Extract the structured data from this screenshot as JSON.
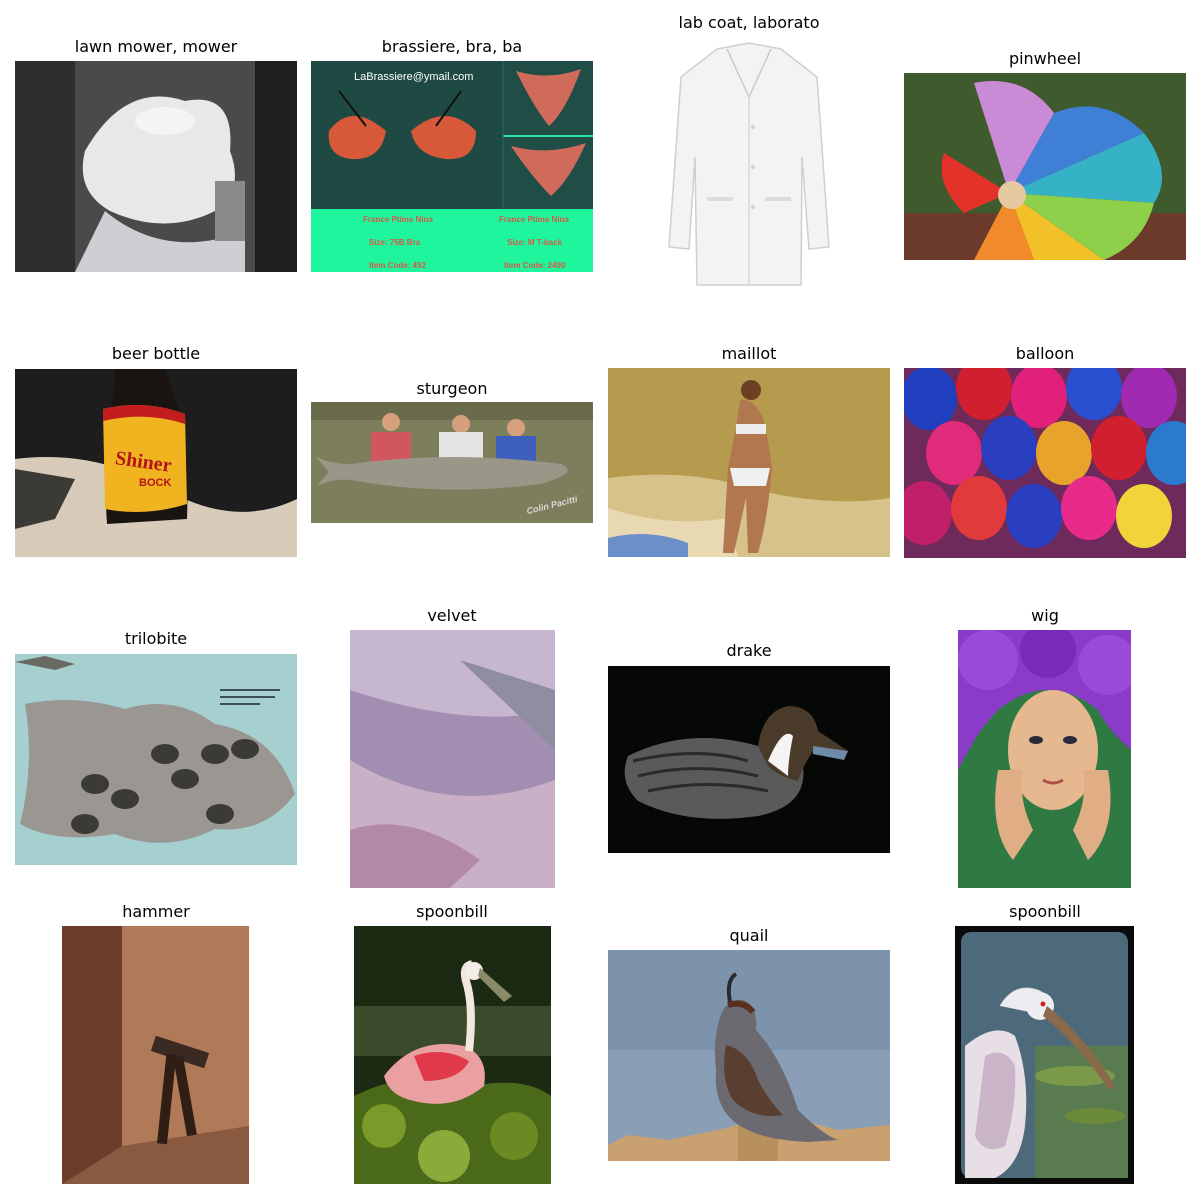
{
  "grid": {
    "cells": [
      {
        "label": "lawn mower, mower"
      },
      {
        "label": "brassiere, bra, ba"
      },
      {
        "label": "lab coat, laborato"
      },
      {
        "label": "pinwheel"
      },
      {
        "label": "beer bottle"
      },
      {
        "label": "sturgeon"
      },
      {
        "label": "maillot"
      },
      {
        "label": "balloon"
      },
      {
        "label": "trilobite"
      },
      {
        "label": "velvet"
      },
      {
        "label": "drake"
      },
      {
        "label": "wig"
      },
      {
        "label": "hammer"
      },
      {
        "label": "spoonbill"
      },
      {
        "label": "quail"
      },
      {
        "label": "spoonbill"
      }
    ]
  },
  "image_text": {
    "bra_email": "LaBrassiere@ymail.com",
    "bra_left": [
      "France Ptima Nina",
      "Size: 75B  Bra",
      "Item Code: 492"
    ],
    "bra_right": [
      "France Ptima Nina",
      "Size: M T-back",
      "Item Code: 2490"
    ],
    "beer_brand": "Shiner",
    "beer_sub": "BOCK",
    "sturgeon_sig": "Colin Pacitti"
  }
}
